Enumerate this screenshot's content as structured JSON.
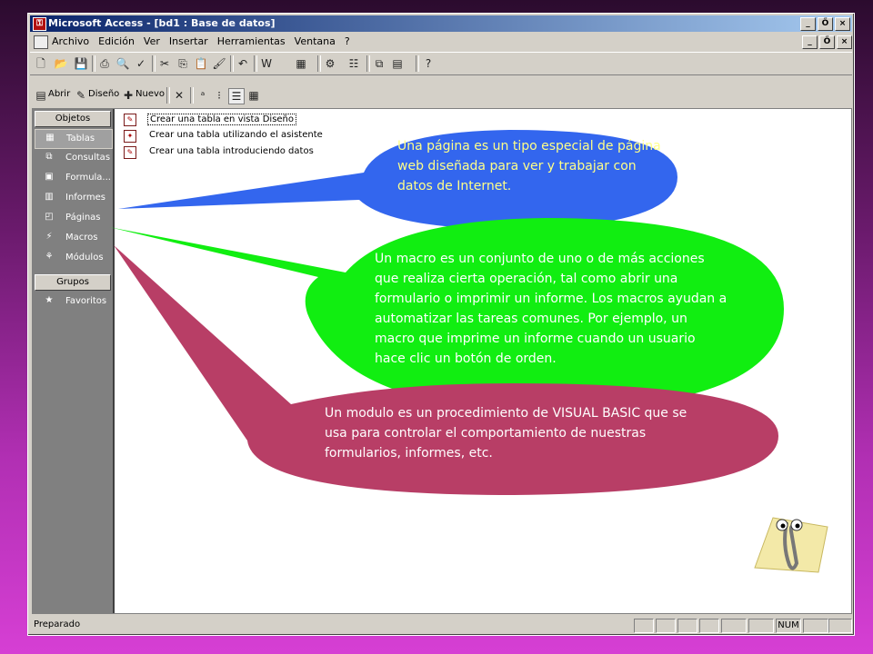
{
  "window": {
    "title": "Microsoft Access - [bd1 : Base de datos]"
  },
  "caption_buttons": [
    "_",
    "Ő",
    "×"
  ],
  "menu": [
    "Archivo",
    "Edición",
    "Ver",
    "Insertar",
    "Herramientas",
    "Ventana",
    "?"
  ],
  "db_toolbar": {
    "open": "Abrir",
    "design": "Diseño",
    "new": "Nuevo"
  },
  "left_pane": {
    "objects_header": "Objetos",
    "objects": [
      {
        "label": "Tablas",
        "icon": "table-icon"
      },
      {
        "label": "Consultas",
        "icon": "query-icon"
      },
      {
        "label": "Formula...",
        "icon": "form-icon"
      },
      {
        "label": "Informes",
        "icon": "report-icon"
      },
      {
        "label": "Páginas",
        "icon": "page-icon"
      },
      {
        "label": "Macros",
        "icon": "macro-icon"
      },
      {
        "label": "Módulos",
        "icon": "module-icon"
      }
    ],
    "groups_header": "Grupos",
    "groups": [
      {
        "label": "Favoritos",
        "icon": "favorites-icon"
      }
    ]
  },
  "right_list": [
    "Crear una tabla en vista Diseño",
    "Crear una tabla utilizando el asistente",
    "Crear una tabla introduciendo datos"
  ],
  "status": {
    "text": "Preparado",
    "num": "NUM"
  },
  "callouts": {
    "pages": "Una página es un tipo especial de página web diseñada para ver y trabajar con datos de Internet.",
    "macros": "Un macro es un conjunto de uno o de más acciones que realiza cierta operación, tal como abrir una formulario o imprimir un informe. Los macros ayudan a automatizar las tareas comunes. Por ejemplo, un macro que imprime un informe cuando un usuario hace clic un botón de orden.",
    "modules": "Un modulo es un procedimiento de VISUAL BASIC que se usa para controlar el comportamiento de nuestras formularios, informes, etc."
  },
  "colors": {
    "callout_pages": "#3366ee",
    "callout_macros": "#11ee11",
    "callout_modules": "#b83e66",
    "text_yellow": "#ffff88"
  }
}
